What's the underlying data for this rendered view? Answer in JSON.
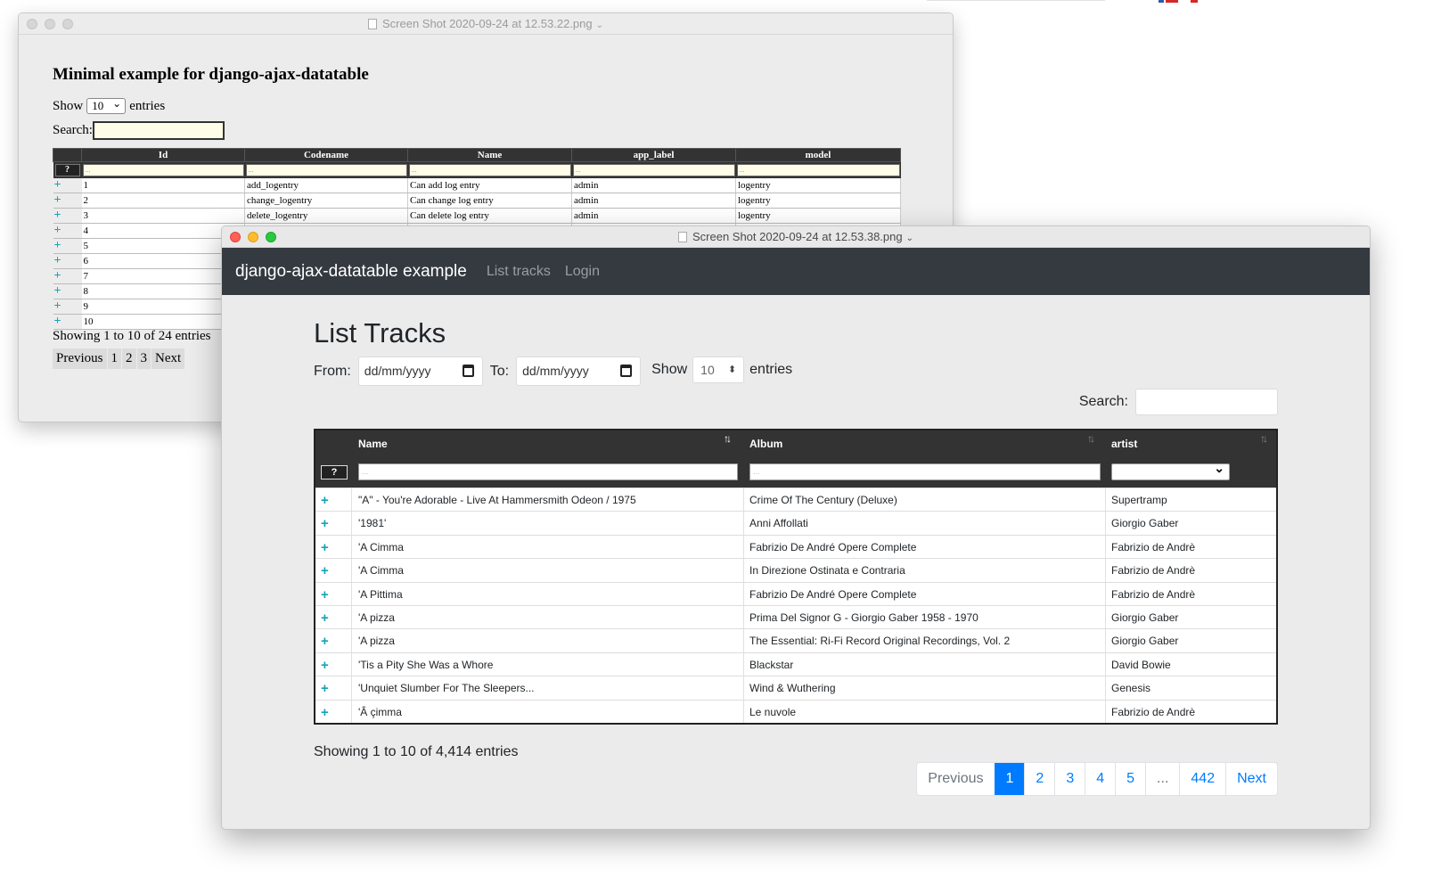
{
  "window_back": {
    "title": "Screen Shot 2020-09-24 at 12.53.22.png",
    "heading": "Minimal example for django-ajax-datatable",
    "show_label": "Show",
    "show_value": "10",
    "entries_label": "entries",
    "search_label": "Search:",
    "columns": [
      "Id",
      "Codename",
      "Name",
      "app_label",
      "model"
    ],
    "filter_placeholder": "...",
    "filter_button": "?",
    "rows": [
      [
        "1",
        "add_logentry",
        "Can add log entry",
        "admin",
        "logentry"
      ],
      [
        "2",
        "change_logentry",
        "Can change log entry",
        "admin",
        "logentry"
      ],
      [
        "3",
        "delete_logentry",
        "Can delete log entry",
        "admin",
        "logentry"
      ],
      [
        "4",
        "",
        "",
        "",
        ""
      ],
      [
        "5",
        "",
        "",
        "",
        ""
      ],
      [
        "6",
        "",
        "",
        "",
        ""
      ],
      [
        "7",
        "",
        "",
        "",
        ""
      ],
      [
        "8",
        "",
        "",
        "",
        ""
      ],
      [
        "9",
        "",
        "",
        "",
        ""
      ],
      [
        "10",
        "",
        "",
        "",
        ""
      ]
    ],
    "info": "Showing 1 to 10 of 24 entries",
    "pagination": [
      "Previous",
      "1",
      "2",
      "3",
      "Next"
    ]
  },
  "window_front": {
    "title": "Screen Shot 2020-09-24 at 12.53.38.png",
    "navbar": {
      "brand": "django-ajax-datatable example",
      "links": [
        "List tracks",
        "Login"
      ]
    },
    "heading": "List Tracks",
    "from_label": "From:",
    "to_label": "To:",
    "date_placeholder": "dd/mm/yyyy",
    "show_label": "Show",
    "show_value": "10",
    "entries_label": "entries",
    "search_label": "Search:",
    "columns": [
      "Name",
      "Album",
      "artist"
    ],
    "filter_placeholder": "...",
    "filter_button": "?",
    "rows": [
      [
        "\"A\" - You're Adorable - Live At Hammersmith Odeon / 1975",
        "Crime Of The Century (Deluxe)",
        "Supertramp"
      ],
      [
        "'1981'",
        "Anni Affollati",
        "Giorgio Gaber"
      ],
      [
        "'A Cimma",
        "Fabrizio De André Opere Complete",
        "Fabrizio de Andrè"
      ],
      [
        "'A Cimma",
        "In Direzione Ostinata e Contraria",
        "Fabrizio de Andrè"
      ],
      [
        "'A Pittima",
        "Fabrizio De André Opere Complete",
        "Fabrizio de Andrè"
      ],
      [
        "'A pizza",
        "Prima Del Signor G - Giorgio Gaber 1958 - 1970",
        "Giorgio Gaber"
      ],
      [
        "'A pizza",
        "The Essential: Ri-Fi Record Original Recordings, Vol. 2",
        "Giorgio Gaber"
      ],
      [
        "'Tis a Pity She Was a Whore",
        "Blackstar",
        "David Bowie"
      ],
      [
        "'Unquiet Slumber For The Sleepers...",
        "Wind & Wuthering",
        "Genesis"
      ],
      [
        "'Â çimma",
        "Le nuvole",
        "Fabrizio de Andrè"
      ]
    ],
    "info": "Showing 1 to 10 of 4,414 entries",
    "pagination": [
      "Previous",
      "1",
      "2",
      "3",
      "4",
      "5",
      "...",
      "442",
      "Next"
    ],
    "active_page": "1"
  },
  "colors": {
    "navbar": "#343a40",
    "accent": "#007bff",
    "plus": "#17a2b8"
  }
}
